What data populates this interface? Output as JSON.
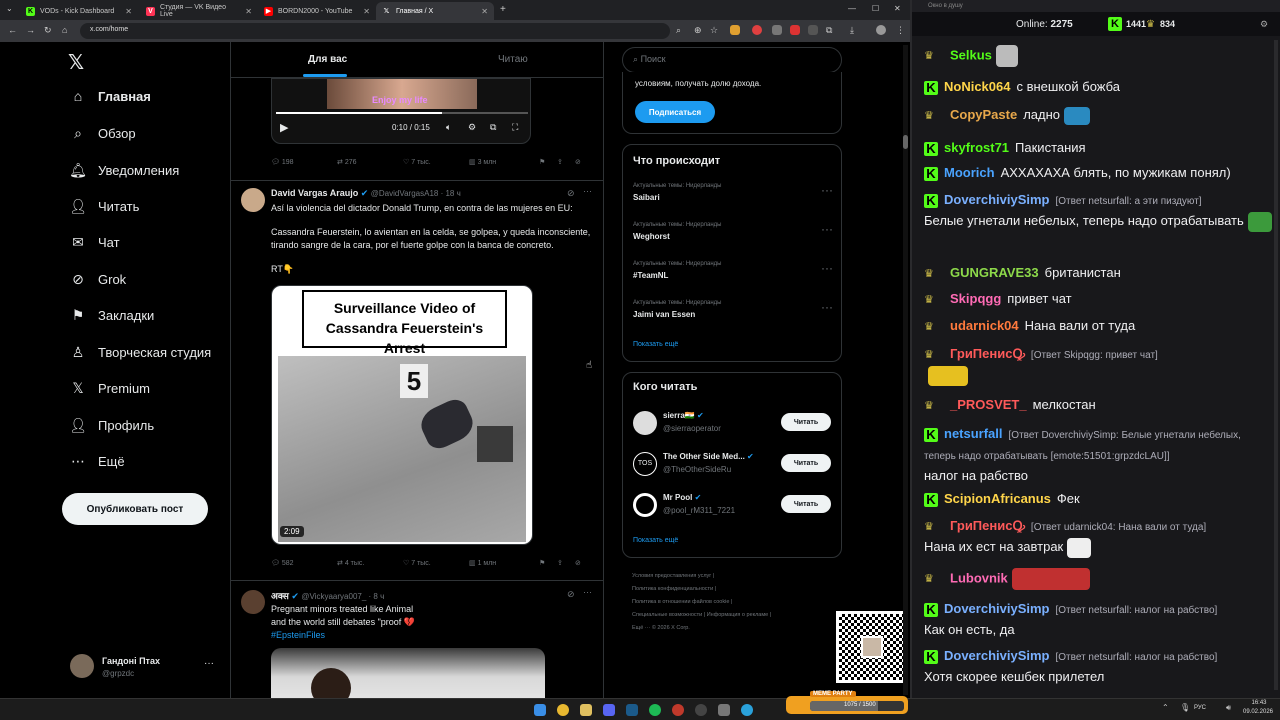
{
  "browser": {
    "tabs": [
      {
        "title": "VODs - Kick Dashboard",
        "fav": "K",
        "color": "#53fc18"
      },
      {
        "title": "Студия — VK Видео Live",
        "fav": "V",
        "color": "#ff3355"
      },
      {
        "title": "BORDN2000 - YouTube",
        "fav": "▶",
        "color": "#ff0000"
      },
      {
        "title": "Главная / X",
        "fav": "X",
        "color": "#ffffff"
      }
    ],
    "url": "x.com/home"
  },
  "nav": {
    "items": [
      "Главная",
      "Обзор",
      "Уведомления",
      "Читать",
      "Чат",
      "Grok",
      "Закладки",
      "Творческая студия",
      "Premium",
      "Профиль",
      "Ещё"
    ],
    "post_button": "Опубликовать пост",
    "user_name": "Гандоні Птах",
    "user_handle": "@grpzdc"
  },
  "feed": {
    "tabs": [
      "Для вас",
      "Читаю"
    ],
    "video1": {
      "caption": "Enjoy my life",
      "time": "0:10 / 0:15"
    },
    "tweet1_actions": [
      "198",
      "276",
      "7 тыс.",
      "3 млн"
    ],
    "tweet2": {
      "name": "David Vargas Araujo",
      "handle": "@DavidVargasA18 · 18 ч",
      "text1": "Así la violencia del dictador Donald Trump, en contra de las mujeres en EU:",
      "text2": "Cassandra Feuerstein, lo avientan en la celda, se golpea, y queda inconsciente, tirando sangre de la cara, por el fuerte golpe con la banca de concreto.",
      "text3": "RT👇",
      "media_title": "Surveillance Video of Cassandra Feuerstein's Arrest",
      "duration": "2:09",
      "actions": [
        "582",
        "4 тыс.",
        "7 тыс.",
        "1 млн"
      ]
    },
    "tweet3": {
      "name": "अक्स",
      "handle": "@Vickyaarya007_ · 8 ч",
      "text1": "Pregnant minors treated like Animal",
      "text2": "and the world still debates \"proof 💔",
      "hashtag": "#EpsteinFiles"
    }
  },
  "right": {
    "search_placeholder": "Поиск",
    "premium_text": "условиям, получать долю дохода.",
    "subscribe": "Подписаться",
    "trends_title": "Что происходит",
    "trends": [
      {
        "meta": "Актуальные темы: Нидерланды",
        "name": "Saibari"
      },
      {
        "meta": "Актуальные темы: Нидерланды",
        "name": "Weghorst"
      },
      {
        "meta": "Актуальные темы: Нидерланды",
        "name": "#TeamNL"
      },
      {
        "meta": "Актуальные темы: Нидерланды",
        "name": "Jaimi van Essen"
      }
    ],
    "show_more": "Показать ещё",
    "who_title": "Кого читать",
    "who": [
      {
        "name": "sierra🇮🇳",
        "handle": "@sierraoperator"
      },
      {
        "name": "The Other Side Med...",
        "handle": "@TheOtherSideRu"
      },
      {
        "name": "Mr Pool",
        "handle": "@pool_rM311_7221"
      }
    ],
    "follow": "Читать",
    "show_more2": "Показать ещё",
    "footer": [
      "Условия предоставления услуг",
      "Политика конфиденциальности",
      "Политика в отношении файлов cookie",
      "Специальные возможности",
      "Информация о рекламе",
      "Ещё ···",
      "© 2026 X Corp."
    ]
  },
  "chat": {
    "window_title": "Окно в душу",
    "online_label": "Online:",
    "online": "2275",
    "kick_count": "1441",
    "other_count": "834",
    "messages": [
      {
        "badge": "crown",
        "user": "Selkus",
        "color": "#53fc18",
        "text": ""
      },
      {
        "badge": "kick",
        "user": "NoNick064",
        "color": "#ffd54a",
        "text": "с внешкой божба"
      },
      {
        "badge": "crown",
        "user": "CopyPaste",
        "color": "#e8a84b",
        "text": "ладно"
      },
      {
        "badge": "kick",
        "user": "skyfrost71",
        "color": "#53fc18",
        "text": "Пакистания"
      },
      {
        "badge": "kick",
        "user": "Moorich",
        "color": "#4aa3ff",
        "text": "АХХАХАХА блять, по мужикам понял)"
      },
      {
        "badge": "kick",
        "user": "DoverchiviySimp",
        "color": "#7ab0ff",
        "reply": "[Ответ netsurfall: а эти пиздуют]",
        "text": "Белые угнетали небелых, теперь надо отрабатывать"
      },
      {
        "badge": "crown",
        "user": "GUNGRAVE33",
        "color": "#8dd94a",
        "text": "британистан"
      },
      {
        "badge": "crown",
        "user": "Skipqgg",
        "color": "#ff6bb5",
        "text": "привет чат"
      },
      {
        "badge": "crown",
        "user": "udarnick04",
        "color": "#ff7a3d",
        "text": "Нана вали от туда"
      },
      {
        "badge": "crown",
        "user": "ГриПенисꝘ",
        "color": "#ff5a5a",
        "reply": "[Ответ Skipqgg: привет чат]",
        "text": ""
      },
      {
        "badge": "crown",
        "user": "_PROSVET_",
        "color": "#ff5a5a",
        "text": "мелкостан"
      },
      {
        "badge": "kick",
        "user": "netsurfall",
        "color": "#4aa3ff",
        "reply": "[Ответ DoverchiviySimp: Белые угнетали небелых, теперь надо отрабатывать [emote:51501:grpzdcLAU]]",
        "text": "налог на рабство"
      },
      {
        "badge": "kick",
        "user": "ScipionAfricanus",
        "color": "#ffd54a",
        "text": "Фек"
      },
      {
        "badge": "crown",
        "user": "ГриПенисꝘ",
        "color": "#ff5a5a",
        "reply": "[Ответ udarnick04: Нана вали от туда]",
        "text": "Нана их ест на завтрак"
      },
      {
        "badge": "crown",
        "user": "Lubovnik",
        "color": "#ff6bb5",
        "text": ""
      },
      {
        "badge": "kick",
        "user": "DoverchiviySimp",
        "color": "#7ab0ff",
        "reply": "[Ответ netsurfall: налог на рабство]",
        "text": "Как он есть, да"
      },
      {
        "badge": "kick",
        "user": "DoverchiviySimp",
        "color": "#7ab0ff",
        "reply": "[Ответ netsurfall: налог на рабство]",
        "text": "Хотя скорее кешбек прилетел"
      }
    ]
  },
  "overlay": {
    "label": "MEME PARTY",
    "progress": "1075 / 1500"
  },
  "taskbar": {
    "lang": "РУС",
    "time": "16:43",
    "date": "09.02.2026"
  }
}
